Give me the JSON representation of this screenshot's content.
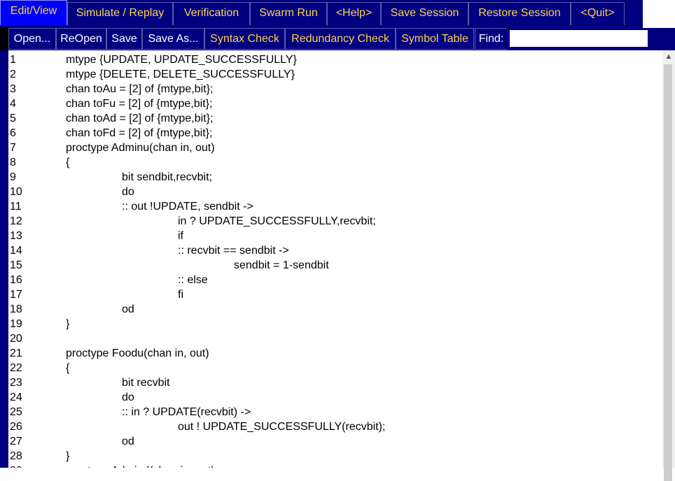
{
  "tabs": [
    {
      "label": "Edit/View",
      "active": true
    },
    {
      "label": "Simulate / Replay",
      "active": false
    },
    {
      "label": "Verification",
      "active": false
    },
    {
      "label": "Swarm Run",
      "active": false
    },
    {
      "label": "<Help>",
      "active": false
    },
    {
      "label": "Save Session",
      "active": false
    },
    {
      "label": "Restore Session",
      "active": false
    },
    {
      "label": "<Quit>",
      "active": false
    }
  ],
  "toolbar": {
    "open": "Open...",
    "reopen": "ReOpen",
    "save": "Save",
    "save_as": "Save As...",
    "syntax_check": "Syntax Check",
    "redundancy_check": "Redundancy Check",
    "symbol_table": "Symbol Table",
    "find_label": "Find:",
    "find_value": ""
  },
  "code_lines": [
    {
      "n": "1",
      "indent": 1,
      "text": "mtype {UPDATE, UPDATE_SUCCESSFULLY}"
    },
    {
      "n": "2",
      "indent": 1,
      "text": "mtype {DELETE, DELETE_SUCCESSFULLY}"
    },
    {
      "n": "3",
      "indent": 1,
      "text": "chan toAu = [2] of {mtype,bit};"
    },
    {
      "n": "4",
      "indent": 1,
      "text": "chan toFu = [2] of {mtype,bit};"
    },
    {
      "n": "5",
      "indent": 1,
      "text": "chan toAd = [2] of {mtype,bit};"
    },
    {
      "n": "6",
      "indent": 1,
      "text": "chan toFd = [2] of {mtype,bit};"
    },
    {
      "n": "7",
      "indent": 1,
      "text": "proctype Adminu(chan in, out)"
    },
    {
      "n": "8",
      "indent": 1,
      "text": "{"
    },
    {
      "n": "9",
      "indent": 2,
      "text": "bit sendbit,recvbit;"
    },
    {
      "n": "10",
      "indent": 2,
      "text": "do"
    },
    {
      "n": "11",
      "indent": 2,
      "text": ":: out !UPDATE, sendbit ->"
    },
    {
      "n": "12",
      "indent": 3,
      "text": "in ? UPDATE_SUCCESSFULLY,recvbit;"
    },
    {
      "n": "13",
      "indent": 3,
      "text": "if"
    },
    {
      "n": "14",
      "indent": 3,
      "text": ":: recvbit == sendbit ->"
    },
    {
      "n": "15",
      "indent": 4,
      "text": "sendbit = 1-sendbit"
    },
    {
      "n": "16",
      "indent": 3,
      "text": ":: else"
    },
    {
      "n": "17",
      "indent": 3,
      "text": "fi"
    },
    {
      "n": "18",
      "indent": 2,
      "text": "od"
    },
    {
      "n": "19",
      "indent": 1,
      "text": "}"
    },
    {
      "n": "20",
      "indent": 1,
      "text": ""
    },
    {
      "n": "21",
      "indent": 1,
      "text": "proctype Foodu(chan in, out)"
    },
    {
      "n": "22",
      "indent": 1,
      "text": "{"
    },
    {
      "n": "23",
      "indent": 2,
      "text": "bit recvbit"
    },
    {
      "n": "24",
      "indent": 2,
      "text": "do"
    },
    {
      "n": "25",
      "indent": 2,
      "text": ":: in ? UPDATE(recvbit) ->"
    },
    {
      "n": "26",
      "indent": 3,
      "text": "out ! UPDATE_SUCCESSFULLY(recvbit);"
    },
    {
      "n": "27",
      "indent": 2,
      "text": "od"
    },
    {
      "n": "28",
      "indent": 1,
      "text": "}"
    },
    {
      "n": "29",
      "indent": 1,
      "text": "proctype Admind(chan in, out)"
    }
  ],
  "scrollbar": {
    "up_icon": "chevron-up-icon"
  },
  "colors": {
    "tab_bg": "#000080",
    "tab_active_bg": "#0000ff",
    "tab_text": "#ffd34d",
    "button_text": "#ffffff",
    "editor_bg": "#ffffff"
  }
}
